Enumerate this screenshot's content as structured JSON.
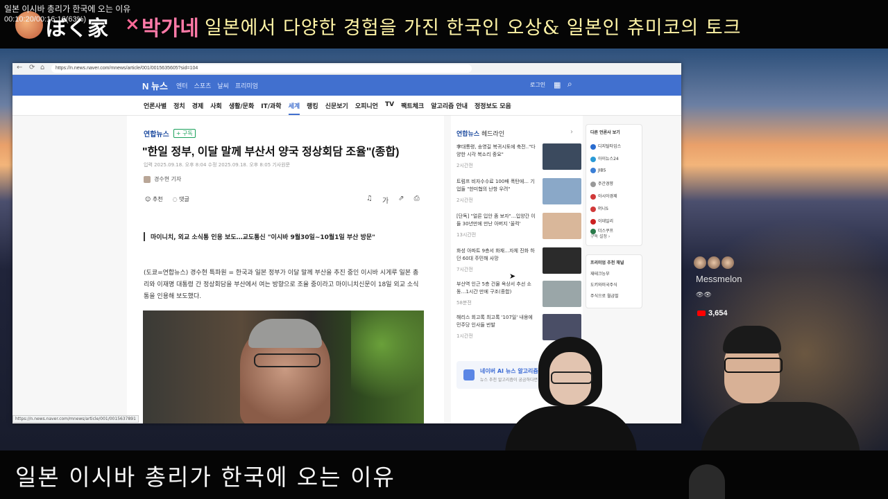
{
  "video": {
    "title": "일본 이시바 총리가 한국에 오는 이유",
    "timecode": "00:10:20/00:16:16(63%)"
  },
  "banner": {
    "logo_part1": "ぼく家",
    "logo_x": "×",
    "logo_part2": "박가네",
    "subtitle": "일본에서 다양한 경험을 가진 한국인 오상& 일본인 츄미코의 토크"
  },
  "caption": "일본 이시바 총리가 한국에 오는 이유",
  "browser": {
    "url": "https://n.news.naver.com/mnews/article/001/0015635605?sid=104",
    "status_url": "https://n.news.naver.com/mnews/article/001/0015637891"
  },
  "naver": {
    "logo": "N 뉴스",
    "services": [
      "엔터",
      "스포츠",
      "날씨",
      "프리미엄"
    ],
    "login": "로그인",
    "categories": [
      "언론사별",
      "정치",
      "경제",
      "사회",
      "생활/문화",
      "IT/과학",
      "세계",
      "랭킹",
      "신문보기",
      "오피니언",
      "TV",
      "팩트체크",
      "알고리즘 안내",
      "정정보도 모음"
    ],
    "active_category": "세계"
  },
  "article": {
    "press": "연합뉴스",
    "subscribe": "+ 구독",
    "headline": "\"한일 정부, 이달 말께 부산서 양국 정상회담 조율\"(종합)",
    "dateline": "입력 2025.09.18. 오후 8:04   수정 2025.09.18. 오후 8:05   기사원문",
    "reporter": "경수현 기자",
    "recommend": "추천",
    "comments": "댓글",
    "summary": "마이니치, 외교 소식통 인용 보도…교도통신 \"이시바 9월30일~10월1일 부산 방문\"",
    "body": "(도쿄=연합뉴스) 경수현 특파원 = 한국과 일본 정부가 이달 말께 부산을 추진 중인 이시바 시게루 일본 총리와 이재명 대통령 간 정상회담을 부산에서 여는 방향으로 조율 중이라고 마이니치신문이 18일 외교 소식통을 인용해 보도했다."
  },
  "headlines": {
    "press": "연합뉴스",
    "label": "헤드라인",
    "items": [
      {
        "text": "李대통령, 송영길 복귀시토에 축전..\"다양한 시각 복소리 중요\"",
        "time": "2시간전",
        "color": "#3b4a5e"
      },
      {
        "text": "트럼프 비자수수료 100배 폭탄에... 기업들 \"한미협의 난항 우려\"",
        "time": "2시간전",
        "color": "#8aa8c8"
      },
      {
        "text": "[단독] \"얼른 입안 좀 보자\"…입양간 이들 30년만에 만난 아버지 '울컥'",
        "time": "13시간전",
        "color": "#d9b79a"
      },
      {
        "text": "화성 아파트 9층서 화재…자체 진화 하던 60대 주민해 사망",
        "time": "7시간전",
        "color": "#2b2b2b"
      },
      {
        "text": "부산역 인근 5층 건물 옥상서 추선 소동…1시간 만에 구조(종합)",
        "time": "58분전",
        "color": "#9aa6a8"
      },
      {
        "text": "해리스 회고록 최고록 '107일' 내용에 민주당 인사들 반발",
        "time": "1시간전",
        "color": "#4a4e66"
      }
    ],
    "ai_title": "네이버 AI 뉴스 알고리즘",
    "ai_sub": "뉴스 추천 알고리즘이 궁금하다면"
  },
  "press_panel": {
    "title": "다른 언론사 보기",
    "items": [
      {
        "name": "디지털타임스",
        "color": "#2a6ccf"
      },
      {
        "name": "아이뉴스24",
        "color": "#2a9ad6"
      },
      {
        "name": "JIBS",
        "color": "#3b7fd6"
      },
      {
        "name": "주간경향",
        "color": "#999999"
      },
      {
        "name": "아시아경제",
        "color": "#d13a3a"
      },
      {
        "name": "머니S",
        "color": "#d13a3a"
      },
      {
        "name": "이데일리",
        "color": "#c22"
      },
      {
        "name": "더스쿠프",
        "color": "#2a7a4a"
      }
    ],
    "more": "구독 설정 ›"
  },
  "rec_panel": {
    "title": "프리미엄 추천 채널",
    "items": [
      "재테크능부",
      "도키와미국주식",
      "주식으로 월급벌"
    ]
  },
  "stream": {
    "channel": "Messmelon",
    "eyes": "👁👁",
    "subscribers": "3,654"
  }
}
